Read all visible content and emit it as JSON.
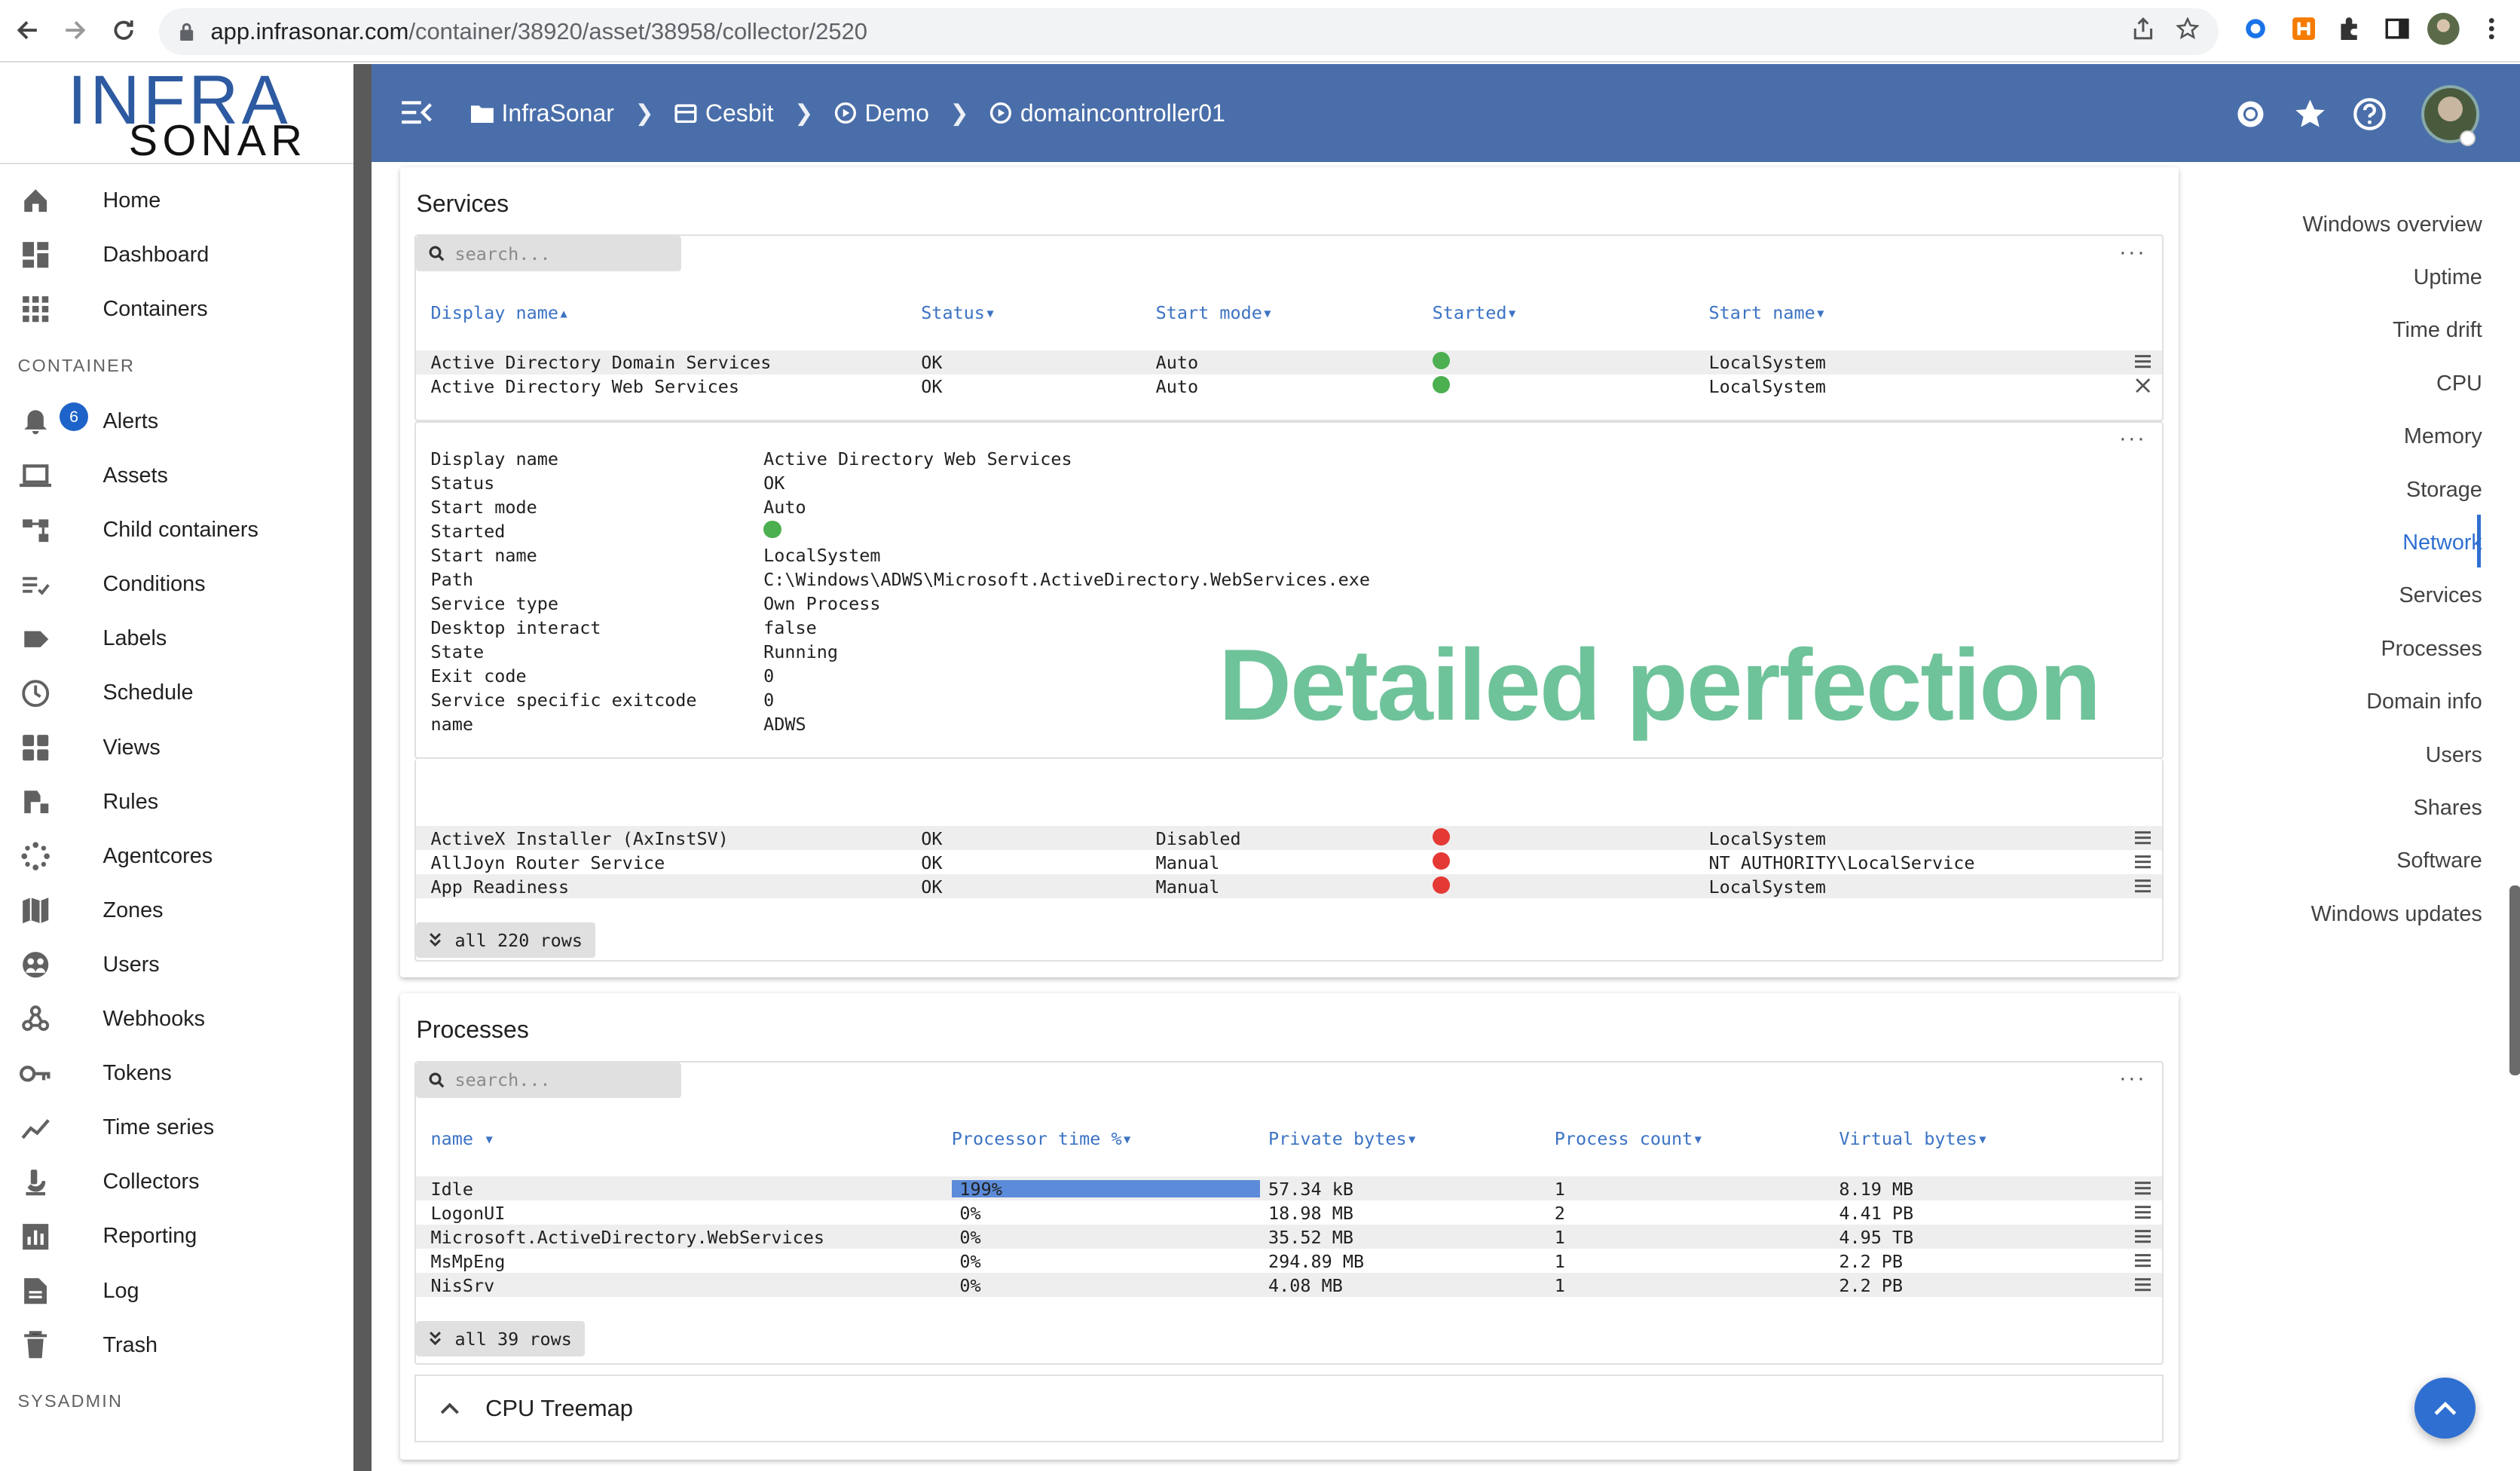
{
  "browser": {
    "url_host": "app.infrasonar.com",
    "url_path": "/container/38920/asset/38958/collector/2520"
  },
  "logo": {
    "top": "INFRA",
    "bottom": "SONAR"
  },
  "sidebar": {
    "items_top": [
      {
        "label": "Home",
        "icon": "home-icon"
      },
      {
        "label": "Dashboard",
        "icon": "dashboard-icon"
      },
      {
        "label": "Containers",
        "icon": "grid-icon"
      }
    ],
    "section_container": "CONTAINER",
    "items_container": [
      {
        "label": "Alerts",
        "icon": "bell-icon",
        "badge": "6"
      },
      {
        "label": "Assets",
        "icon": "laptop-icon"
      },
      {
        "label": "Child containers",
        "icon": "tree-icon"
      },
      {
        "label": "Conditions",
        "icon": "conditions-icon"
      },
      {
        "label": "Labels",
        "icon": "label-icon"
      },
      {
        "label": "Schedule",
        "icon": "clock-icon"
      },
      {
        "label": "Views",
        "icon": "views-icon"
      },
      {
        "label": "Rules",
        "icon": "rules-icon"
      },
      {
        "label": "Agentcores",
        "icon": "agentcore-icon"
      },
      {
        "label": "Zones",
        "icon": "map-icon"
      },
      {
        "label": "Users",
        "icon": "users-icon"
      },
      {
        "label": "Webhooks",
        "icon": "webhook-icon"
      },
      {
        "label": "Tokens",
        "icon": "key-icon"
      },
      {
        "label": "Time series",
        "icon": "trend-icon"
      },
      {
        "label": "Collectors",
        "icon": "collector-icon"
      },
      {
        "label": "Reporting",
        "icon": "report-icon"
      },
      {
        "label": "Log",
        "icon": "log-icon"
      },
      {
        "label": "Trash",
        "icon": "trash-icon"
      }
    ],
    "section_sysadmin": "SYSADMIN"
  },
  "breadcrumb": {
    "items": [
      {
        "label": "InfraSonar",
        "icon": "folder-icon"
      },
      {
        "label": "Cesbit",
        "icon": "container-icon"
      },
      {
        "label": "Demo",
        "icon": "asset-icon"
      },
      {
        "label": "domaincontroller01",
        "icon": "asset-icon"
      }
    ]
  },
  "services": {
    "title": "Services",
    "search_placeholder": "search...",
    "columns": [
      "Display name",
      "Status",
      "Start mode",
      "Started",
      "Start name"
    ],
    "rows_top": [
      {
        "name": "Active Directory Domain Services",
        "status": "OK",
        "mode": "Auto",
        "started": true,
        "start_name": "LocalSystem"
      },
      {
        "name": "Active Directory Web Services",
        "status": "OK",
        "mode": "Auto",
        "started": true,
        "start_name": "LocalSystem"
      }
    ],
    "detail": [
      {
        "label": "Display name",
        "value": "Active Directory Web Services"
      },
      {
        "label": "Status",
        "value": "OK"
      },
      {
        "label": "Start mode",
        "value": "Auto"
      },
      {
        "label": "Started",
        "value": ""
      },
      {
        "label": "Start name",
        "value": "LocalSystem"
      },
      {
        "label": "Path",
        "value": "C:\\Windows\\ADWS\\Microsoft.ActiveDirectory.WebServices.exe"
      },
      {
        "label": "Service type",
        "value": "Own Process"
      },
      {
        "label": "Desktop interact",
        "value": "false"
      },
      {
        "label": "State",
        "value": "Running"
      },
      {
        "label": "Exit code",
        "value": "0"
      },
      {
        "label": "Service specific exitcode",
        "value": "0"
      },
      {
        "label": "name",
        "value": "ADWS"
      }
    ],
    "rows_bottom": [
      {
        "name": "ActiveX Installer (AxInstSV)",
        "status": "OK",
        "mode": "Disabled",
        "started": false,
        "start_name": "LocalSystem"
      },
      {
        "name": "AllJoyn Router Service",
        "status": "OK",
        "mode": "Manual",
        "started": false,
        "start_name": "NT AUTHORITY\\LocalService"
      },
      {
        "name": "App Readiness",
        "status": "OK",
        "mode": "Manual",
        "started": false,
        "start_name": "LocalSystem"
      }
    ],
    "all_rows": "all 220 rows"
  },
  "promo_text": "Detailed perfection",
  "processes": {
    "title": "Processes",
    "search_placeholder": "search...",
    "columns": [
      "name",
      "Processor time %",
      "Private bytes",
      "Process count",
      "Virtual bytes"
    ],
    "rows": [
      {
        "name": "Idle",
        "cpu": "199%",
        "cpu_fraction": 1.0,
        "private": "57.34 kB",
        "count": "1",
        "virtual": "8.19 MB"
      },
      {
        "name": "LogonUI",
        "cpu": "0%",
        "cpu_fraction": 0,
        "private": "18.98 MB",
        "count": "2",
        "virtual": "4.41 PB"
      },
      {
        "name": "Microsoft.ActiveDirectory.WebServices",
        "cpu": "0%",
        "cpu_fraction": 0,
        "private": "35.52 MB",
        "count": "1",
        "virtual": "4.95 TB"
      },
      {
        "name": "MsMpEng",
        "cpu": "0%",
        "cpu_fraction": 0,
        "private": "294.89 MB",
        "count": "1",
        "virtual": "2.2 PB"
      },
      {
        "name": "NisSrv",
        "cpu": "0%",
        "cpu_fraction": 0,
        "private": "4.08 MB",
        "count": "1",
        "virtual": "2.2 PB"
      }
    ],
    "all_rows": "all 39 rows"
  },
  "cpu_treemap": {
    "title": "CPU Treemap"
  },
  "right_nav": {
    "items": [
      "Windows overview",
      "Uptime",
      "Time drift",
      "CPU",
      "Memory",
      "Storage",
      "Network",
      "Services",
      "Processes",
      "Domain info",
      "Users",
      "Shares",
      "Software",
      "Windows updates"
    ],
    "active": "Network"
  },
  "colors": {
    "header": "#4a6ea9",
    "accent": "#2f6fd1",
    "ok": "#4caf50",
    "stopped": "#e53935",
    "promo": "#6fc39a"
  }
}
